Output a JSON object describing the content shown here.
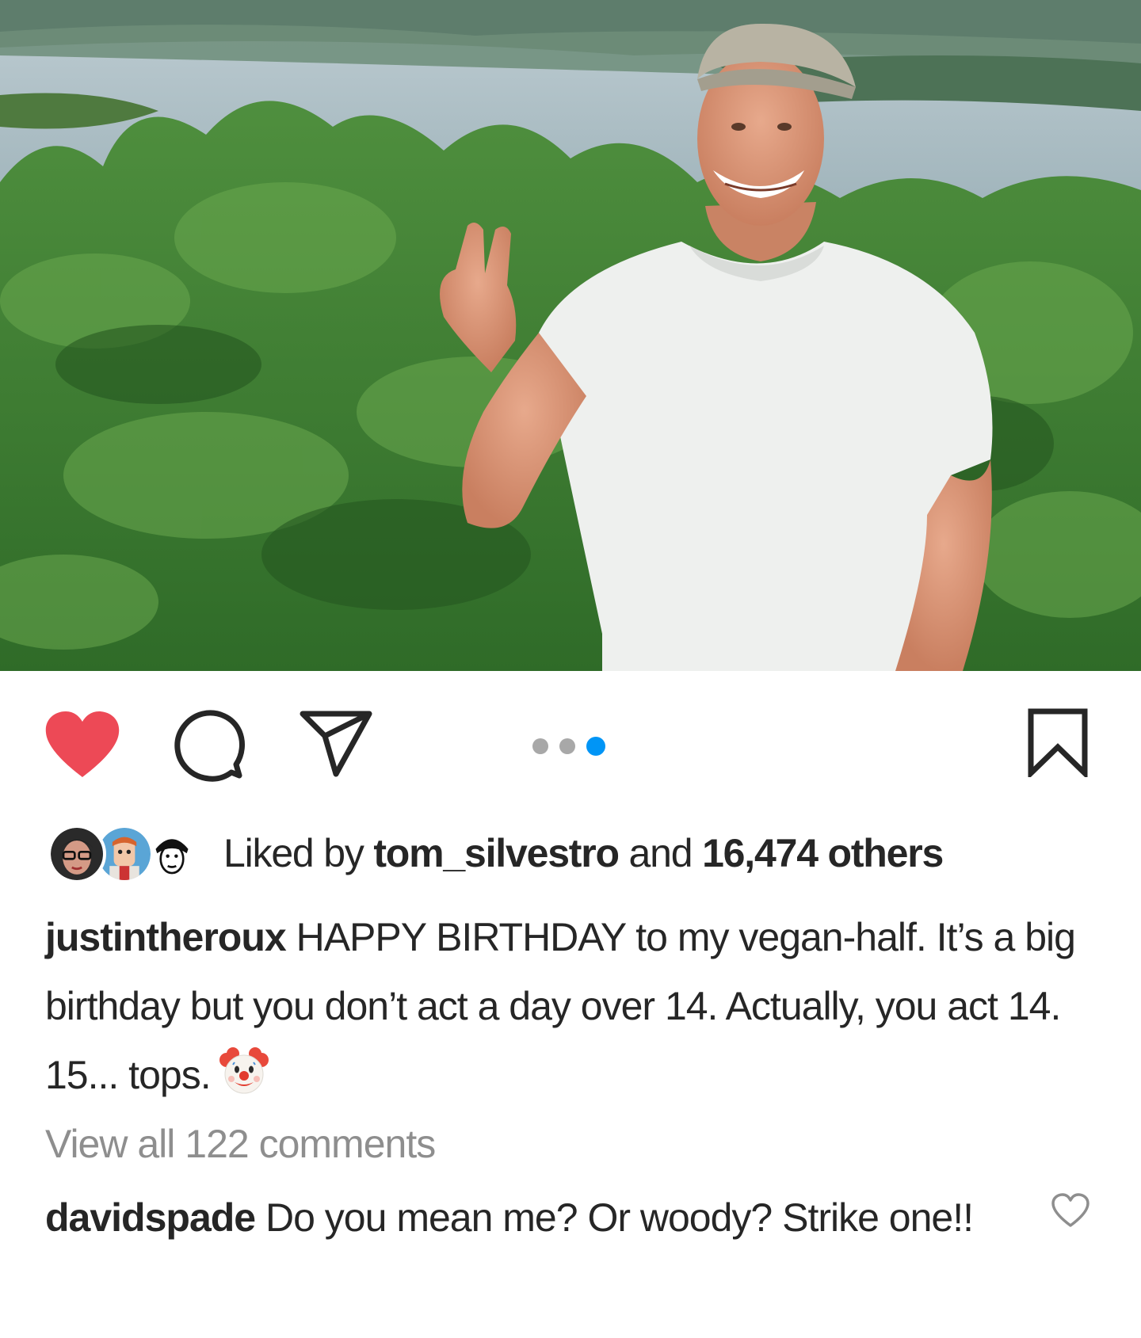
{
  "post": {
    "image_alt": "Smiling man in a white t-shirt and cap giving a peace sign in front of green bushes and a river",
    "carousel": {
      "count": 3,
      "active_index": 2
    },
    "liked": true
  },
  "actions": {
    "like_icon": "heart-filled-icon",
    "comment_icon": "comment-bubble-icon",
    "share_icon": "paper-plane-icon",
    "save_icon": "bookmark-icon",
    "like_color": "#ed4956",
    "active_dot_color": "#0095f6"
  },
  "likes": {
    "prefix": "Liked by ",
    "user": "tom_silvestro",
    "middle": " and ",
    "others": "16,474 others"
  },
  "caption": {
    "username": "justintheroux",
    "text": " HAPPY BIRTHDAY to my vegan-half.  It’s a big birthday but you don’t act a day over 14. Actually, you act 14. 15... tops.",
    "emoji": "clown-face-emoji"
  },
  "view_all_comments": "View all 122 comments",
  "comments": [
    {
      "username": "davidspade",
      "text": " Do you mean me? Or woody?  Strike one!!"
    }
  ]
}
